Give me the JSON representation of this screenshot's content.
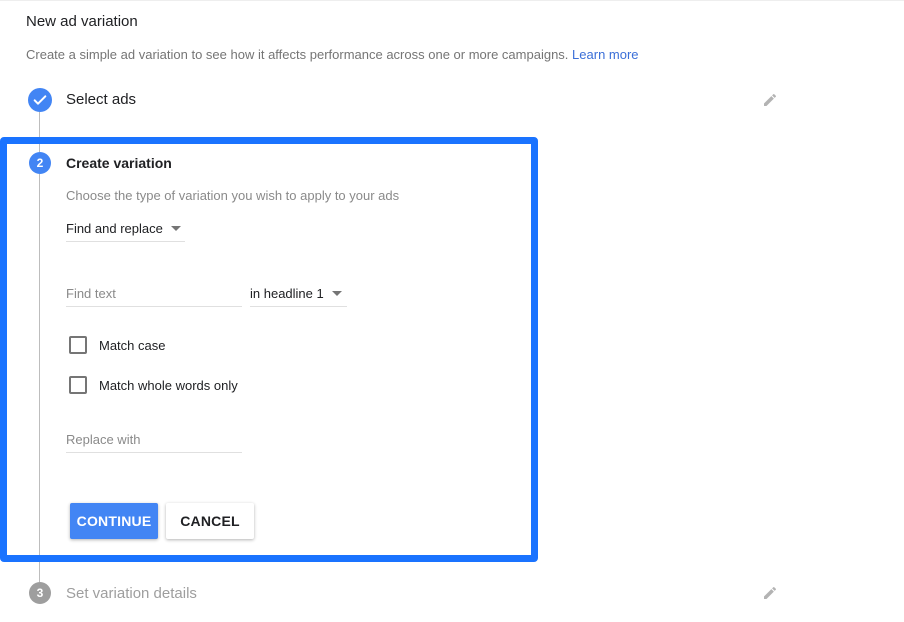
{
  "header": {
    "title": "New ad variation",
    "subtitle": "Create a simple ad variation to see how it affects performance across one or more campaigns.",
    "learn_more": "Learn more"
  },
  "colors": {
    "accent": "#4285f4",
    "highlight_border": "#1a73ff",
    "link": "#3b6fd8",
    "pending": "#9e9e9e"
  },
  "steps": [
    {
      "number": "1",
      "label": "Select ads",
      "state": "completed",
      "icon": "check-icon",
      "edit_icon": "pencil-icon"
    },
    {
      "number": "2",
      "label": "Create variation",
      "state": "active",
      "hint": "Choose the type of variation you wish to apply to your ads",
      "variation_type": {
        "selected": "Find and replace"
      },
      "find_text": {
        "placeholder": "Find text",
        "value": ""
      },
      "find_field": {
        "selected": "in headline 1"
      },
      "options": [
        {
          "label": "Match case",
          "checked": false
        },
        {
          "label": "Match whole words only",
          "checked": false
        }
      ],
      "replace_with": {
        "placeholder": "Replace with",
        "value": ""
      },
      "buttons": {
        "continue": "CONTINUE",
        "cancel": "CANCEL"
      }
    },
    {
      "number": "3",
      "label": "Set variation details",
      "state": "pending",
      "edit_icon": "pencil-icon"
    }
  ]
}
